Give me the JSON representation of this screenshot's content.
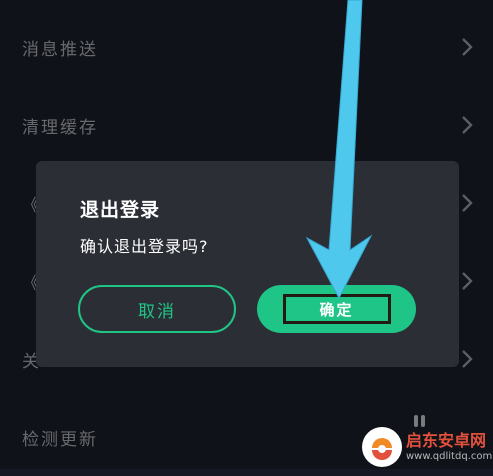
{
  "settings": {
    "items": [
      {
        "label": "消息推送"
      },
      {
        "label": "清理缓存"
      },
      {
        "label": "《"
      },
      {
        "label": "《"
      },
      {
        "label": "关"
      },
      {
        "label": "检测更新"
      }
    ]
  },
  "dialog": {
    "title": "退出登录",
    "message": "确认退出登录吗?",
    "cancel_label": "取消",
    "confirm_label": "确定"
  },
  "watermark": {
    "brand": "启东安卓网",
    "url": "www.qdlitdq.com"
  },
  "colors": {
    "background": "#161823",
    "dialog_bg": "#2b2e35",
    "accent": "#1fc586",
    "arrow": "#4fc8ee"
  },
  "icons": {
    "row_chevron": "chevron-right-icon",
    "annotation": "pointer-arrow-icon"
  }
}
